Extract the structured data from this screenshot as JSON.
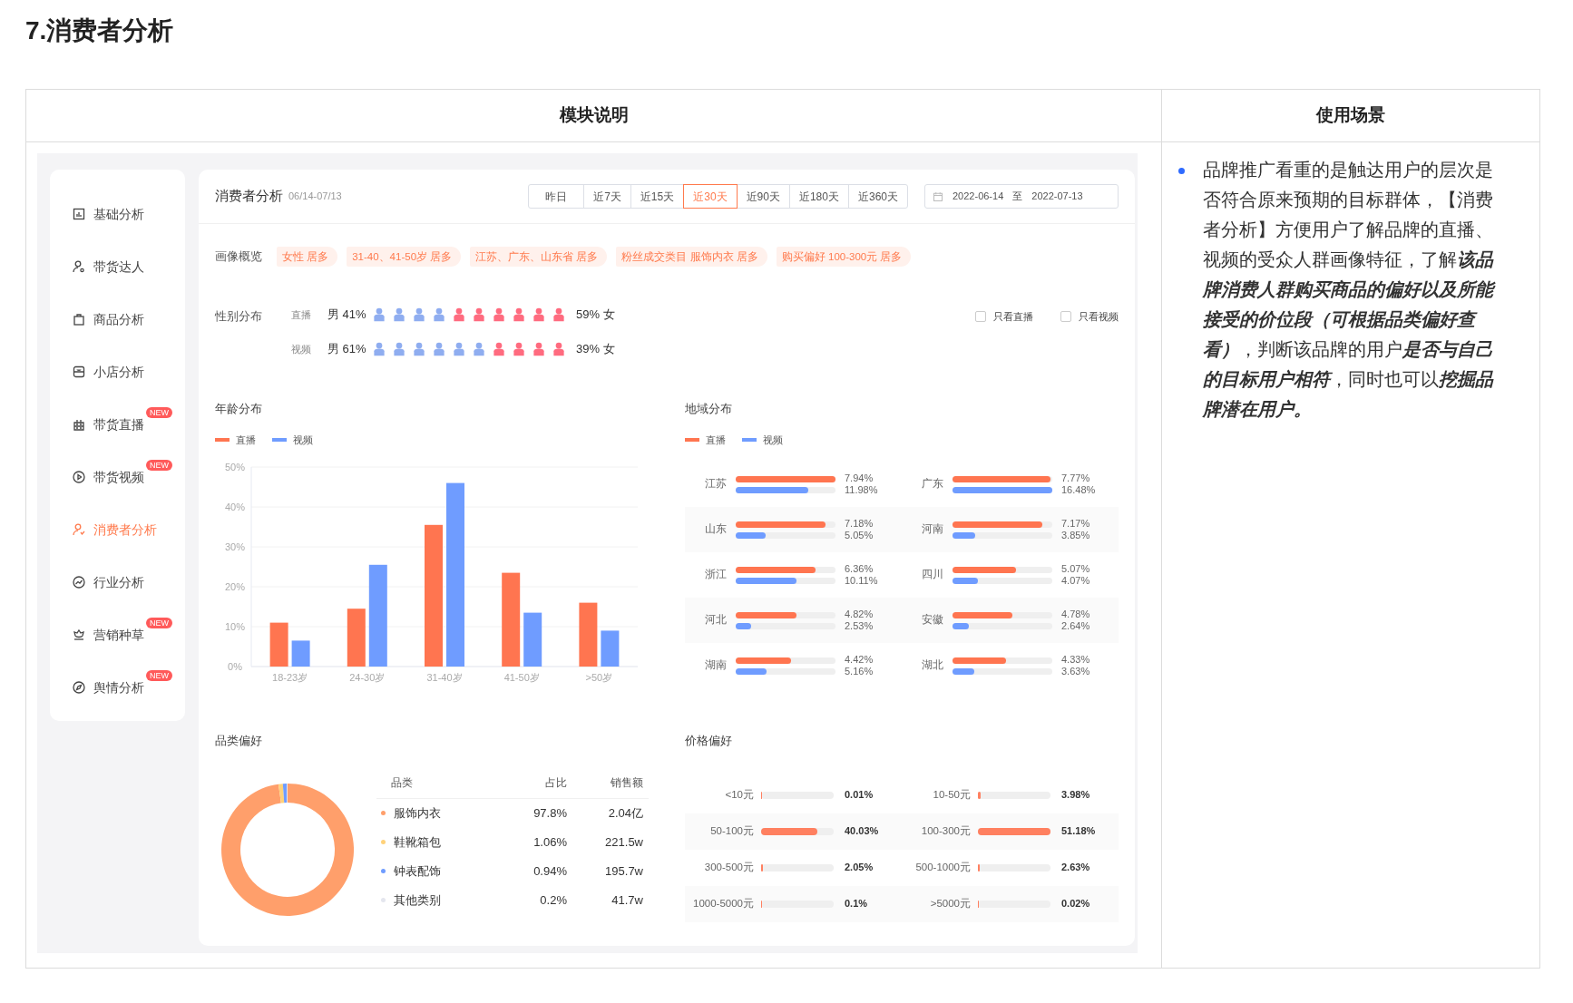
{
  "title": "7.消费者分析",
  "table": {
    "columns": [
      "模块说明",
      "使用场景"
    ]
  },
  "sidebar": {
    "items": [
      {
        "label": "基础分析",
        "selected": false
      },
      {
        "label": "带货达人",
        "selected": false
      },
      {
        "label": "商品分析",
        "selected": false
      },
      {
        "label": "小店分析",
        "selected": false
      },
      {
        "label": "带货直播",
        "selected": false,
        "badge": "NEW"
      },
      {
        "label": "带货视频",
        "selected": false,
        "badge": "NEW"
      },
      {
        "label": "消费者分析",
        "selected": true
      },
      {
        "label": "行业分析",
        "selected": false
      },
      {
        "label": "营销种草",
        "selected": false,
        "badge": "NEW"
      },
      {
        "label": "舆情分析",
        "selected": false,
        "badge": "NEW"
      }
    ]
  },
  "header": {
    "title": "消费者分析",
    "date_range": "06/14-07/13",
    "ranges": [
      {
        "label": "昨日",
        "selected": false
      },
      {
        "label": "近7天",
        "selected": false
      },
      {
        "label": "近15天",
        "selected": false
      },
      {
        "label": "近30天",
        "selected": true
      },
      {
        "label": "近90天",
        "selected": false
      },
      {
        "label": "近180天",
        "selected": false
      },
      {
        "label": "近360天",
        "selected": false
      }
    ],
    "date_picker": {
      "start": "2022-06-14",
      "separator": "至",
      "end": "2022-07-13"
    }
  },
  "overview": {
    "label": "画像概览",
    "tags": [
      "女性 居多",
      "31-40、41-50岁 居多",
      "江苏、广东、山东省 居多",
      "粉丝成交类目 服饰内衣 居多",
      "购买偏好 100-300元 居多"
    ]
  },
  "gender": {
    "label": "性别分布",
    "rows": [
      {
        "name": "直播",
        "male": "男 41%",
        "female": "59% 女",
        "figures": [
          {
            "kind": "male"
          },
          {
            "kind": "male"
          },
          {
            "kind": "male"
          },
          {
            "kind": "male"
          },
          {
            "kind": "female"
          },
          {
            "kind": "female"
          },
          {
            "kind": "female"
          },
          {
            "kind": "female"
          },
          {
            "kind": "female"
          },
          {
            "kind": "female"
          }
        ]
      },
      {
        "name": "视频",
        "male": "男 61%",
        "female": "39% 女",
        "figures": [
          {
            "kind": "male"
          },
          {
            "kind": "male"
          },
          {
            "kind": "male"
          },
          {
            "kind": "male"
          },
          {
            "kind": "male"
          },
          {
            "kind": "male"
          },
          {
            "kind": "female"
          },
          {
            "kind": "female"
          },
          {
            "kind": "female"
          },
          {
            "kind": "female"
          }
        ]
      }
    ],
    "filters": [
      {
        "label": "只看直播",
        "checked": false
      },
      {
        "label": "只看视频",
        "checked": false
      }
    ]
  },
  "age": {
    "title": "年龄分布",
    "chart_data": {
      "type": "bar",
      "grid": true,
      "legend": "top",
      "categories": [
        "18-23岁",
        "24-30岁",
        "31-40岁",
        "41-50岁",
        ">50岁"
      ],
      "series": [
        {
          "name": "直播",
          "color": "#ff7550",
          "values": [
            11,
            14.5,
            35.5,
            23.5,
            16
          ]
        },
        {
          "name": "视频",
          "color": "#6f9cff",
          "values": [
            6.5,
            25.5,
            46,
            13.5,
            9
          ]
        }
      ],
      "ylim": [
        0,
        50
      ],
      "yticks": [
        {
          "value": 0,
          "label": "0%"
        },
        {
          "value": 10,
          "label": "10%"
        },
        {
          "value": 20,
          "label": "20%"
        },
        {
          "value": 30,
          "label": "30%"
        },
        {
          "value": 40,
          "label": "40%"
        },
        {
          "value": 50,
          "label": "50%"
        }
      ]
    }
  },
  "region": {
    "title": "地域分布",
    "legend": [
      {
        "name": "直播",
        "color": "#ff7550"
      },
      {
        "name": "视频",
        "color": "#6f9cff"
      }
    ],
    "rows": [
      [
        {
          "name": "江苏",
          "live": {
            "value": "7.94%",
            "level": 1
          },
          "video": {
            "value": "11.98%",
            "level": 0.73
          }
        },
        {
          "name": "广东",
          "live": {
            "value": "7.77%",
            "level": 0.98
          },
          "video": {
            "value": "16.48%",
            "level": 1
          }
        }
      ],
      [
        {
          "name": "山东",
          "live": {
            "value": "7.18%",
            "level": 0.9
          },
          "video": {
            "value": "5.05%",
            "level": 0.3
          }
        },
        {
          "name": "河南",
          "live": {
            "value": "7.17%",
            "level": 0.9
          },
          "video": {
            "value": "3.85%",
            "level": 0.23
          }
        }
      ],
      [
        {
          "name": "浙江",
          "live": {
            "value": "6.36%",
            "level": 0.8
          },
          "video": {
            "value": "10.11%",
            "level": 0.61
          }
        },
        {
          "name": "四川",
          "live": {
            "value": "5.07%",
            "level": 0.64
          },
          "video": {
            "value": "4.07%",
            "level": 0.25
          }
        }
      ],
      [
        {
          "name": "河北",
          "live": {
            "value": "4.82%",
            "level": 0.61
          },
          "video": {
            "value": "2.53%",
            "level": 0.15
          }
        },
        {
          "name": "安徽",
          "live": {
            "value": "4.78%",
            "level": 0.6
          },
          "video": {
            "value": "2.64%",
            "level": 0.16
          }
        }
      ],
      [
        {
          "name": "湖南",
          "live": {
            "value": "4.42%",
            "level": 0.55
          },
          "video": {
            "value": "5.16%",
            "level": 0.31
          }
        },
        {
          "name": "湖北",
          "live": {
            "value": "4.33%",
            "level": 0.54
          },
          "video": {
            "value": "3.63%",
            "level": 0.22
          }
        }
      ]
    ]
  },
  "category": {
    "title": "品类偏好",
    "columns": [
      "品类",
      "占比",
      "销售额"
    ],
    "rows": [
      {
        "name": "服饰内衣",
        "share": "97.8%",
        "sales": "2.04亿",
        "color": "#ff9f6b"
      },
      {
        "name": "鞋靴箱包",
        "share": "1.06%",
        "sales": "221.5w",
        "color": "#ffd27a"
      },
      {
        "name": "钟表配饰",
        "share": "0.94%",
        "sales": "195.7w",
        "color": "#6f9cff"
      },
      {
        "name": "其他类别",
        "share": "0.2%",
        "sales": "41.7w",
        "color": "#e4e6ee"
      }
    ]
  },
  "price": {
    "title": "价格偏好",
    "rows": [
      [
        {
          "label": "<10元",
          "value": "0.01%",
          "level": 0.01
        },
        {
          "label": "10-50元",
          "value": "3.98%",
          "level": 0.04
        }
      ],
      [
        {
          "label": "50-100元",
          "value": "40.03%",
          "level": 0.78
        },
        {
          "label": "100-300元",
          "value": "51.18%",
          "level": 1
        }
      ],
      [
        {
          "label": "300-500元",
          "value": "2.05%",
          "level": 0.02
        },
        {
          "label": "500-1000元",
          "value": "2.63%",
          "level": 0.03
        }
      ],
      [
        {
          "label": "1000-5000元",
          "value": "0.1%",
          "level": 0.01
        },
        {
          "label": ">5000元",
          "value": "0.02%",
          "level": 0.01
        }
      ]
    ]
  },
  "usage": {
    "text": "品牌推广看重的是触达用户的层次是否符合原来预期的目标群体，【消费者分析】方便用户了解品牌的直播、视频的受众人群画像特征，了解**该品牌消费人群购买商品的偏好以及所能接受的价位段（可根据品类偏好查看）**，判断该品牌的用户**是否与自己的目标用户相符**，同时也可以**挖掘品牌潜在用户。**"
  }
}
